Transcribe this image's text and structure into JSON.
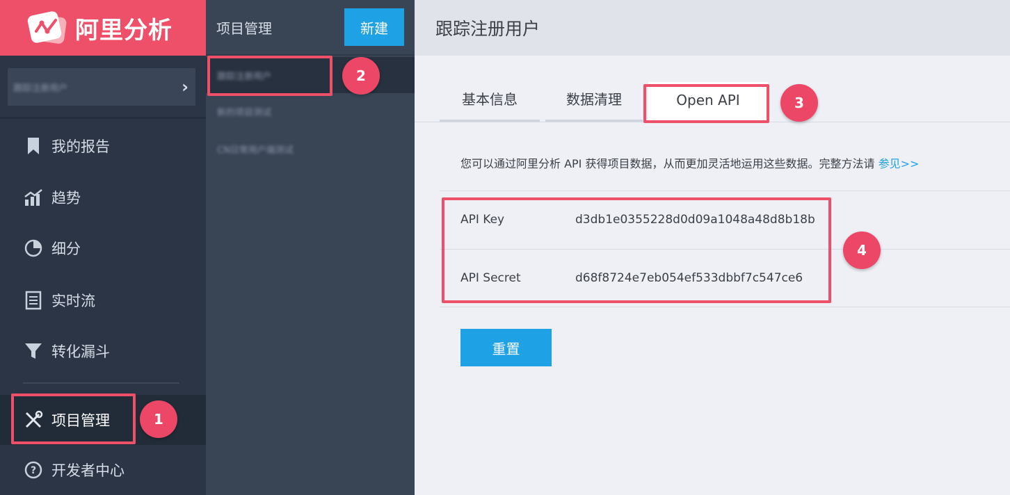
{
  "brand": {
    "logo_text": "阿里分析"
  },
  "sidebar": {
    "project_selector": {
      "value": "跟踪注册用户"
    },
    "items": [
      {
        "label": "我的报告",
        "icon": "bookmark-icon"
      },
      {
        "label": "趋势",
        "icon": "trend-chart-icon"
      },
      {
        "label": "细分",
        "icon": "pie-chart-icon"
      },
      {
        "label": "实时流",
        "icon": "document-icon"
      },
      {
        "label": "转化漏斗",
        "icon": "funnel-icon"
      },
      {
        "label": "项目管理",
        "icon": "tools-icon"
      },
      {
        "label": "开发者中心",
        "icon": "help-icon"
      }
    ]
  },
  "project_panel": {
    "title": "项目管理",
    "new_button": "新建",
    "projects": [
      {
        "label": "跟踪注册用户"
      },
      {
        "label": "新的项目测试"
      },
      {
        "label": "CN日常用户端测试"
      }
    ]
  },
  "main": {
    "page_title": "跟踪注册用户",
    "tabs": [
      {
        "label": "基本信息"
      },
      {
        "label": "数据清理"
      },
      {
        "label": "Open API"
      }
    ],
    "intro_text": "您可以通过阿里分析 API 获得项目数据，从而更加灵活地运用这些数据。完整方法请",
    "intro_link": "参见>>",
    "api": {
      "key_label": "API Key",
      "key_value": "d3db1e0355228d0d09a1048a48d8b18b",
      "secret_label": "API Secret",
      "secret_value": "d68f8724e7eb054ef533dbbf7c547ce6"
    },
    "reset_button": "重置"
  },
  "annotations": [
    "1",
    "2",
    "3",
    "4"
  ],
  "colors": {
    "brand": "#ef5069",
    "accent": "#1fa1e6",
    "sidebar": "#2b3545",
    "panel": "#394455"
  }
}
